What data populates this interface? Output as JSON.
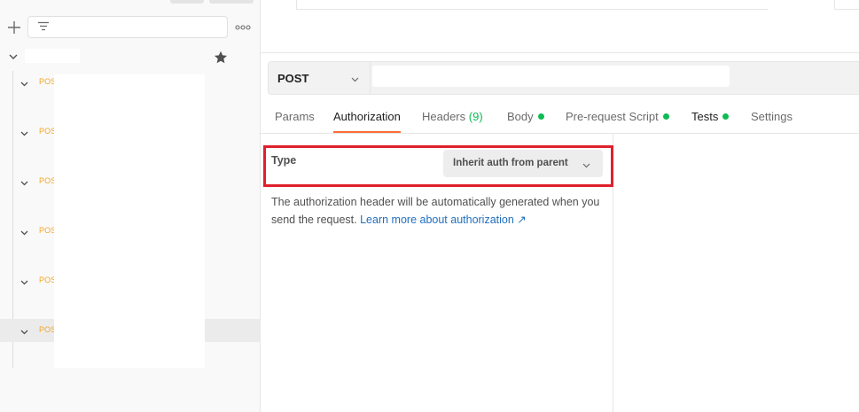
{
  "sidebar": {
    "filter_placeholder": "",
    "request_methods": [
      "POS",
      "POS",
      "POS",
      "POS",
      "POS",
      "POS"
    ]
  },
  "request": {
    "method": "POST",
    "url": ""
  },
  "tabs": {
    "params": "Params",
    "authorization": "Authorization",
    "headers": "Headers",
    "headers_count": "(9)",
    "body": "Body",
    "pre_request": "Pre-request Script",
    "tests": "Tests",
    "settings": "Settings"
  },
  "auth": {
    "type_label": "Type",
    "type_value": "Inherit auth from parent",
    "description": "The authorization header will be automatically generated when you send the request.",
    "link_text": "Learn more about authorization ↗"
  },
  "colors": {
    "post_method": "#f5a623",
    "active_tab_underline": "#ff6c37",
    "status_dot": "#0cbb52",
    "highlight_border": "#e0202b",
    "link": "#1f6fbe"
  }
}
